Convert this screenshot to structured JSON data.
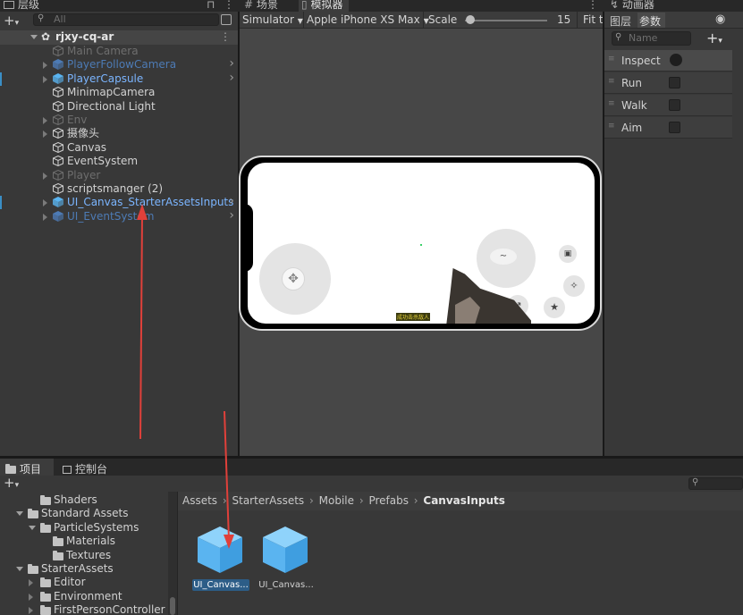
{
  "hierarchy": {
    "tab_label": "层级",
    "lock_icon": "lock-icon",
    "search_placeholder": "All",
    "scene_name": "rjxy-cq-ar",
    "items": [
      {
        "label": "Main Camera",
        "style": "gray"
      },
      {
        "label": "PlayerFollowCamera",
        "style": "bluedim"
      },
      {
        "label": "PlayerCapsule",
        "style": "blue"
      },
      {
        "label": "MinimapCamera",
        "style": "normal"
      },
      {
        "label": "Directional Light",
        "style": "normal"
      },
      {
        "label": "Env",
        "style": "gray"
      },
      {
        "label": "摄像头",
        "style": "normal"
      },
      {
        "label": "Canvas",
        "style": "normal"
      },
      {
        "label": "EventSystem",
        "style": "normal"
      },
      {
        "label": "Player",
        "style": "gray"
      },
      {
        "label": "scriptsmanger (2)",
        "style": "normal"
      },
      {
        "label": "UI_Canvas_StarterAssetsInputs",
        "style": "blue"
      },
      {
        "label": "UI_EventSystem",
        "style": "bluedim"
      }
    ]
  },
  "center": {
    "tab_scene": "场景",
    "tab_simulator": "模拟器",
    "mode_select": "Simulator",
    "device_select": "Apple iPhone XS Max",
    "scale_label": "Scale",
    "scale_value": "15",
    "fit_label": "Fit t"
  },
  "game_view": {
    "banner_text": "成功击杀敌人"
  },
  "animator": {
    "tab_label": "动画器",
    "subtab_layers": "图层",
    "subtab_params": "参数",
    "search_placeholder": "Name",
    "params": [
      {
        "label": "Inspect",
        "type": "trigger"
      },
      {
        "label": "Run",
        "type": "bool"
      },
      {
        "label": "Walk",
        "type": "bool"
      },
      {
        "label": "Aim",
        "type": "bool"
      }
    ]
  },
  "project": {
    "tab_project": "项目",
    "tab_console": "控制台",
    "tree": [
      {
        "label": "Shaders",
        "indent": 1,
        "expanded": null
      },
      {
        "label": "Standard Assets",
        "indent": 0,
        "expanded": true
      },
      {
        "label": "ParticleSystems",
        "indent": 1,
        "expanded": true
      },
      {
        "label": "Materials",
        "indent": 2,
        "expanded": null
      },
      {
        "label": "Textures",
        "indent": 2,
        "expanded": null
      },
      {
        "label": "StarterAssets",
        "indent": 0,
        "expanded": true
      },
      {
        "label": "Editor",
        "indent": 1,
        "expanded": false
      },
      {
        "label": "Environment",
        "indent": 1,
        "expanded": false
      },
      {
        "label": "FirstPersonController",
        "indent": 1,
        "expanded": false
      }
    ],
    "breadcrumb": [
      "Assets",
      "StarterAssets",
      "Mobile",
      "Prefabs",
      "CanvasInputs"
    ],
    "assets": [
      {
        "label": "UI_Canvas...",
        "selected": true
      },
      {
        "label": "UI_Canvas...",
        "selected": false
      }
    ]
  },
  "colors": {
    "annotation_arrow": "#e0403a",
    "selection": "#2c5d87",
    "prefab_blue": "#5ab4f0"
  }
}
